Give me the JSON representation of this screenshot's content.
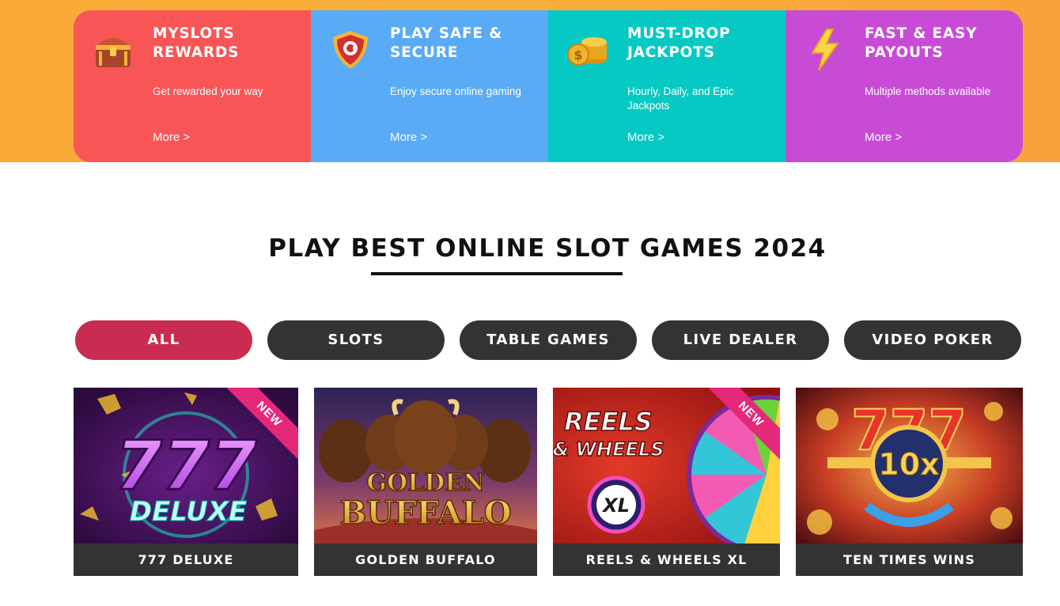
{
  "features": [
    {
      "title": "MYSLOTS\nREWARDS",
      "desc": "Get rewarded your way",
      "more": "More >",
      "icon": "treasure-chest-icon",
      "color": "#f75556"
    },
    {
      "title": "PLAY SAFE &\nSECURE",
      "desc": "Enjoy secure online gaming",
      "more": "More >",
      "icon": "shield-icon",
      "color": "#59abf5"
    },
    {
      "title": "MUST-DROP\nJACKPOTS",
      "desc": "Hourly, Daily, and Epic Jackpots",
      "more": "More >",
      "icon": "coin-stack-icon",
      "color": "#06c9c3"
    },
    {
      "title": "FAST & EASY\nPAYOUTS",
      "desc": "Multiple methods available",
      "more": "More >",
      "icon": "lightning-icon",
      "color": "#c84bd6"
    }
  ],
  "section": {
    "title": "PLAY BEST ONLINE SLOT GAMES 2024"
  },
  "tabs": [
    {
      "label": "ALL",
      "active": true
    },
    {
      "label": "SLOTS",
      "active": false
    },
    {
      "label": "TABLE GAMES",
      "active": false
    },
    {
      "label": "LIVE DEALER",
      "active": false
    },
    {
      "label": "VIDEO POKER",
      "active": false
    }
  ],
  "games": [
    {
      "name": "777 DELUXE",
      "badge": "NEW",
      "art": {
        "line1": "777",
        "line2": "DELUXE"
      }
    },
    {
      "name": "GOLDEN BUFFALO",
      "art": {
        "line1": "GOLDEN",
        "line2": "BUFFALO"
      }
    },
    {
      "name": "REELS & WHEELS XL",
      "badge": "NEW",
      "art": {
        "line1": "REELS",
        "line2": "& WHEELS",
        "badge_text": "XL"
      }
    },
    {
      "name": "TEN TIMES WINS",
      "art": {
        "line1": "10x",
        "ring_text": "TEN TIMES WINS"
      }
    }
  ]
}
